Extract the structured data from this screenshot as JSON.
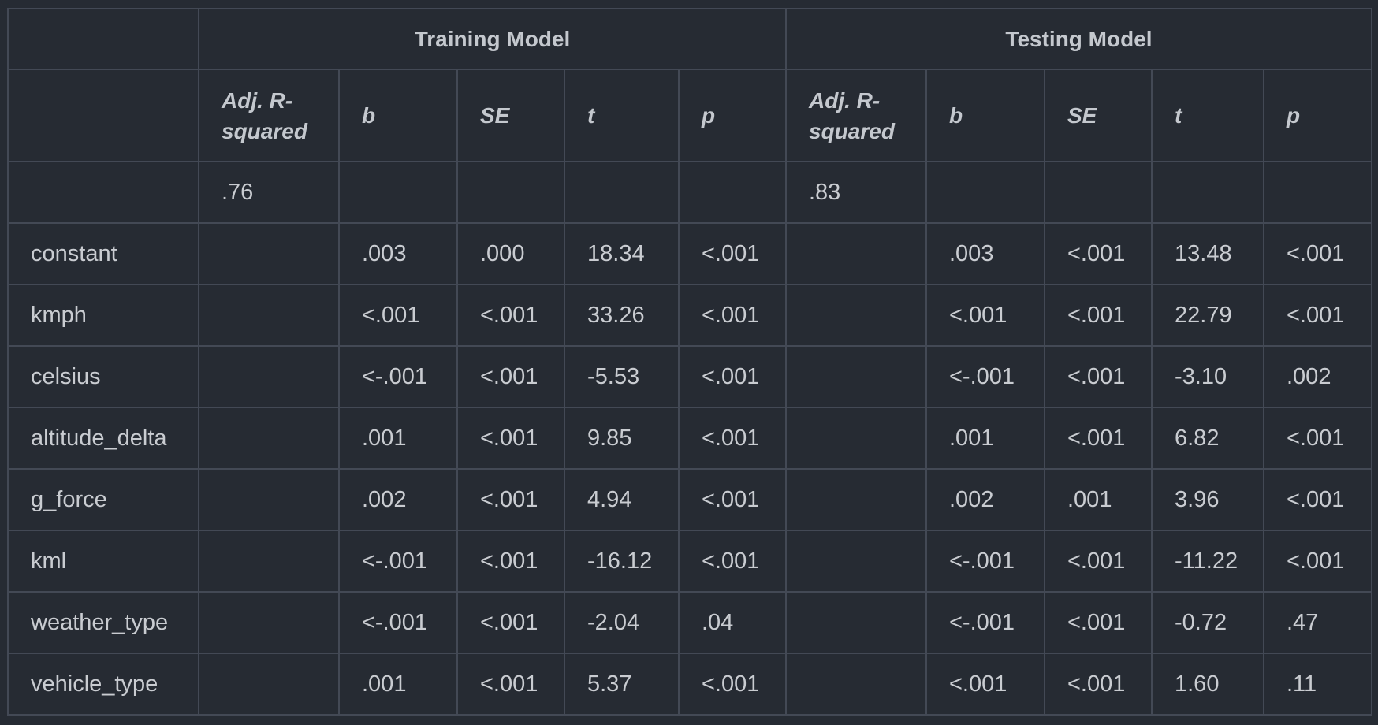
{
  "group_headers": [
    "Training Model",
    "Testing Model"
  ],
  "column_headers": [
    "Adj. R-squared",
    "b",
    "SE",
    "t",
    "p",
    "Adj. R-squared",
    "b",
    "SE",
    "t",
    "p"
  ],
  "r_squared_row": {
    "label": "",
    "cells": [
      ".76",
      "",
      "",
      "",
      "",
      ".83",
      "",
      "",
      "",
      ""
    ]
  },
  "rows": [
    {
      "label": "constant",
      "cells": [
        "",
        ".003",
        ".000",
        "18.34",
        "<.001",
        "",
        ".003",
        "<.001",
        "13.48",
        "<.001"
      ]
    },
    {
      "label": "kmph",
      "cells": [
        "",
        "<.001",
        "<.001",
        "33.26",
        "<.001",
        "",
        "<.001",
        "<.001",
        "22.79",
        "<.001"
      ]
    },
    {
      "label": "celsius",
      "cells": [
        "",
        "<-.001",
        "<.001",
        "-5.53",
        "<.001",
        "",
        "<-.001",
        "<.001",
        "-3.10",
        ".002"
      ]
    },
    {
      "label": "altitude_delta",
      "cells": [
        "",
        ".001",
        "<.001",
        "9.85",
        "<.001",
        "",
        ".001",
        "<.001",
        "6.82",
        "<.001"
      ]
    },
    {
      "label": "g_force",
      "cells": [
        "",
        ".002",
        "<.001",
        "4.94",
        "<.001",
        "",
        ".002",
        ".001",
        "3.96",
        "<.001"
      ]
    },
    {
      "label": "kml",
      "cells": [
        "",
        "<-.001",
        "<.001",
        "-16.12",
        "<.001",
        "",
        "<-.001",
        "<.001",
        "-11.22",
        "<.001"
      ]
    },
    {
      "label": "weather_type",
      "cells": [
        "",
        "<-.001",
        "<.001",
        "-2.04",
        ".04",
        "",
        "<-.001",
        "<.001",
        "-0.72",
        ".47"
      ]
    },
    {
      "label": "vehicle_type",
      "cells": [
        "",
        ".001",
        "<.001",
        "5.37",
        "<.001",
        "",
        "<.001",
        "<.001",
        "1.60",
        ".11"
      ]
    }
  ],
  "colors": {
    "background": "#262b33",
    "border": "#434955",
    "text": "#c9ccd1"
  }
}
